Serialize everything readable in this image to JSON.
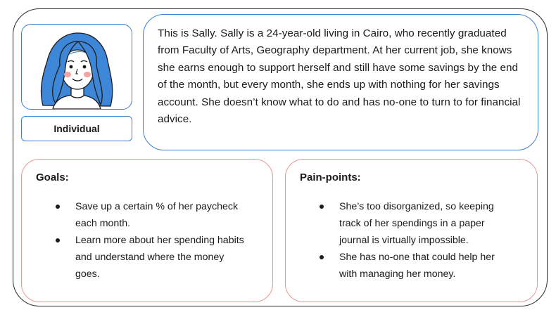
{
  "persona": {
    "role_label": "Individual",
    "bio": "This is Sally. Sally is a 24-year-old living in Cairo, who recently graduated from Faculty of Arts, Geography department. At her current job, she knows she earns enough to support herself and still have some savings by the end of the month, but every month, she ends up with nothing for her savings account. She doesn’t know what to do and has no-one to turn to for financial advice.",
    "avatar_icon": "woman-blue-hair-avatar-icon"
  },
  "goals": {
    "title": "Goals:",
    "items": [
      "Save up a certain % of her paycheck each month.",
      "Learn more about her spending habits and understand where the money goes."
    ]
  },
  "pain_points": {
    "title": "Pain-points:",
    "items": [
      "She’s too disorganized, so keeping track of her spendings in a paper journal is virtually impossible.",
      "She has no-one that could help her with managing her money."
    ]
  },
  "colors": {
    "outer_border": "#2b2b2b",
    "persona_border": "#3f7fd6",
    "card_border": "#e89a94",
    "hair": "#3d86d8"
  }
}
